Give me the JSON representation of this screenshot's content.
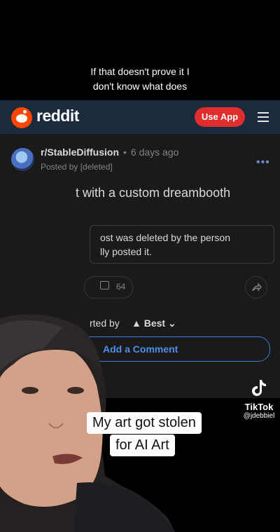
{
  "caption_top": {
    "line1": "If that doesn't prove it I",
    "line2": "don't know what does"
  },
  "reddit": {
    "logo_text": "reddit",
    "use_app_label": "Use App",
    "menu_icon": "hamburger-icon"
  },
  "post": {
    "subreddit": "r/StableDiffusion",
    "separator": "•",
    "age": "6 days ago",
    "posted_by": "Posted by [deleted]",
    "more": "•••",
    "title_fragment": "t with a custom dreambooth",
    "notice_line1": "ost was deleted by the person",
    "notice_line2": "lly posted it.",
    "comment_count": "64",
    "share_icon": "share-arrow-icon"
  },
  "comments": {
    "sort_prefix": "rted by",
    "sort_value": "Best",
    "sort_chevron": "⌄",
    "add_comment": "Add a Comment"
  },
  "tiktok": {
    "name": "TikTok",
    "handle": "@jdebbiel"
  },
  "caption_bottom": {
    "line1": "My art got stolen",
    "line2": "for AI Art"
  }
}
